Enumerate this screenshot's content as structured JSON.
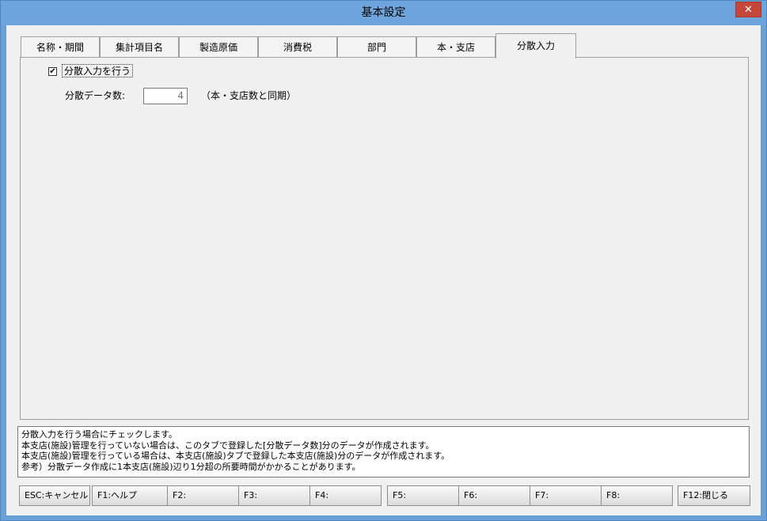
{
  "window": {
    "title": "基本設定",
    "close_glyph": "✕"
  },
  "tabs": [
    {
      "label": "名称・期間"
    },
    {
      "label": "集計項目名"
    },
    {
      "label": "製造原価"
    },
    {
      "label": "消費税"
    },
    {
      "label": "部門"
    },
    {
      "label": "本・支店"
    },
    {
      "label": "分散入力",
      "active": true
    }
  ],
  "panel": {
    "checkbox": {
      "label": "分散入力を行う",
      "checked": true,
      "mark": "✔"
    },
    "field": {
      "label": "分散データ数:",
      "value": "4",
      "note": "（本・支店数と同期）"
    }
  },
  "help": {
    "lines": [
      "分散入力を行う場合にチェックします。",
      "本支店(施設)管理を行っていない場合は、このタブで登録した[分散データ数]分のデータが作成されます。",
      "本支店(施設)管理を行っている場合は、本支店(施設)タブで登録した本支店(施設)分のデータが作成されます。",
      "参考）分散データ作成に1本支店(施設)辺り1分超の所要時間がかかることがあります。"
    ]
  },
  "function_keys": [
    {
      "label": "ESC:キャンセル"
    },
    {
      "label": "F1:ヘルプ"
    },
    {
      "label": "F2:"
    },
    {
      "label": "F3:"
    },
    {
      "label": "F4:"
    },
    {
      "label": "F5:"
    },
    {
      "label": "F6:"
    },
    {
      "label": "F7:"
    },
    {
      "label": "F8:"
    },
    {
      "label": "F12:閉じる"
    }
  ],
  "colors": {
    "titlebar": "#6ea5dc",
    "close_button": "#c7463c",
    "client": "#f0f0f0"
  }
}
